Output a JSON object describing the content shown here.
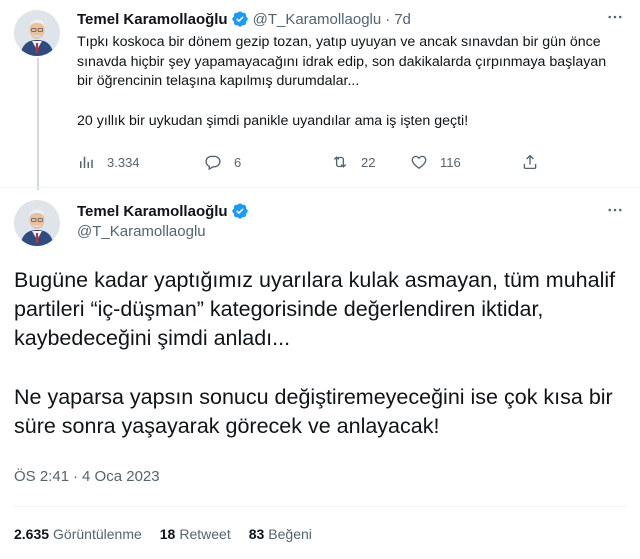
{
  "colors": {
    "verified_blue": "#1d9bf0",
    "secondary_text": "#536471",
    "primary_text": "#0f1419",
    "thread_line": "#cfd9de"
  },
  "parent_tweet": {
    "avatar_icon": "profile-photo",
    "author_name": "Temel Karamollaoğlu",
    "verified_icon": "verified-badge-icon",
    "handle": "@T_Karamollaoglu",
    "separator": "·",
    "time": "7d",
    "more_icon": "more-options-icon",
    "text_paragraphs": [
      "Tıpkı koskoca bir dönem gezip tozan, yatıp uyuyan ve ancak sınavdan bir gün önce sınavda hiçbir şey yapamayacağını idrak edip, son dakikalarda çırpınmaya başlayan bir öğrencinin telaşına kapılmış durumdalar...",
      "20 yıllık bir uykudan şimdi panikle uyandılar ama iş işten geçti!"
    ],
    "actions": {
      "views": {
        "icon": "analytics-icon",
        "count": "3.334"
      },
      "reply": {
        "icon": "reply-icon",
        "count": "6"
      },
      "retweet": {
        "icon": "retweet-icon",
        "count": "22"
      },
      "like": {
        "icon": "heart-icon",
        "count": "116"
      },
      "share": {
        "icon": "share-icon"
      }
    }
  },
  "main_tweet": {
    "avatar_icon": "profile-photo",
    "author_name": "Temel Karamollaoğlu",
    "verified_icon": "verified-badge-icon",
    "handle": "@T_Karamollaoglu",
    "more_icon": "more-options-icon",
    "text_paragraphs": [
      "Bugüne kadar yaptığımız uyarılara kulak asmayan, tüm muhalif partileri “iç-düşman” kategorisinde değerlendiren iktidar, kaybedeceğini şimdi anladı...",
      "Ne yaparsa yapsın sonucu değiştiremeyeceğini ise çok kısa bir süre sonra yaşayarak görecek ve anlayacak!"
    ],
    "timestamp": {
      "time": "ÖS 2:41",
      "separator": "·",
      "date": "4 Oca 2023"
    },
    "stats": {
      "views_count": "2.635",
      "views_label": "Görüntülenme",
      "retweets_count": "18",
      "retweets_label": "Retweet",
      "likes_count": "83",
      "likes_label": "Beğeni"
    }
  }
}
